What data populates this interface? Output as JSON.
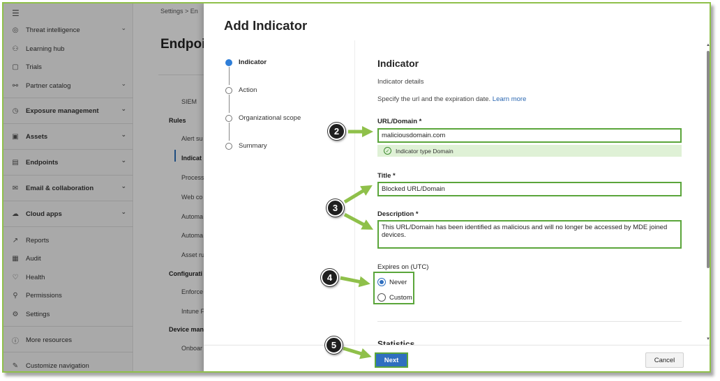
{
  "nav": {
    "items": [
      {
        "label": "Threat intelligence",
        "icon": "threat-icon",
        "chevron": true,
        "bold": false
      },
      {
        "label": "Learning hub",
        "icon": "learning-icon",
        "chevron": false,
        "bold": false
      },
      {
        "label": "Trials",
        "icon": "gift-icon",
        "chevron": false,
        "bold": false
      },
      {
        "label": "Partner catalog",
        "icon": "partner-icon",
        "chevron": true,
        "bold": false
      },
      {
        "label": "Exposure management",
        "icon": "exposure-icon",
        "chevron": true,
        "bold": true
      },
      {
        "label": "Assets",
        "icon": "assets-icon",
        "chevron": true,
        "bold": true
      },
      {
        "label": "Endpoints",
        "icon": "endpoints-icon",
        "chevron": true,
        "bold": true
      },
      {
        "label": "Email & collaboration",
        "icon": "mail-icon",
        "chevron": true,
        "bold": true
      },
      {
        "label": "Cloud apps",
        "icon": "cloud-icon",
        "chevron": true,
        "bold": true
      },
      {
        "label": "Reports",
        "icon": "reports-icon",
        "chevron": false,
        "bold": false
      },
      {
        "label": "Audit",
        "icon": "audit-icon",
        "chevron": false,
        "bold": false
      },
      {
        "label": "Health",
        "icon": "health-icon",
        "chevron": false,
        "bold": false
      },
      {
        "label": "Permissions",
        "icon": "permissions-icon",
        "chevron": false,
        "bold": false
      },
      {
        "label": "Settings",
        "icon": "settings-icon",
        "chevron": false,
        "bold": false
      },
      {
        "label": "More resources",
        "icon": "info-icon",
        "chevron": false,
        "bold": false
      },
      {
        "label": "Customize navigation",
        "icon": "pencil-icon",
        "chevron": false,
        "bold": false
      }
    ]
  },
  "background": {
    "breadcrumb": "Settings  >  En",
    "title": "Endpoi",
    "items": {
      "siem": "SIEM",
      "rules_head": "Rules",
      "alert": "Alert su",
      "indicators": "Indicat",
      "process": "Process",
      "web": "Web co",
      "automa1": "Automa",
      "automa2": "Automa",
      "asset": "Asset ru",
      "config_head": "Configurati",
      "enforce": "Enforce",
      "intune": "Intune F",
      "device_head": "Device man",
      "onboard": "Onboar"
    }
  },
  "dialog": {
    "title": "Add Indicator",
    "steps": [
      {
        "label": "Indicator",
        "active": true
      },
      {
        "label": "Action",
        "active": false
      },
      {
        "label": "Organizational scope",
        "active": false
      },
      {
        "label": "Summary",
        "active": false
      }
    ],
    "form": {
      "heading": "Indicator",
      "subheading": "Indicator details",
      "description": "Specify the url and the expiration date.",
      "learn_more": "Learn more",
      "url_label": "URL/Domain *",
      "url_value": "maliciousdomain.com",
      "validation": "Indicator type Domain",
      "title_label": "Title *",
      "title_value": "Blocked URL/Domain",
      "desc_label": "Description *",
      "desc_value": "This URL/Domain has been identified as malicious and will no longer be accessed by MDE joined devices.",
      "expires_label": "Expires on (UTC)",
      "option_never": "Never",
      "option_custom": "Custom",
      "statistics_heading": "Statistics"
    },
    "buttons": {
      "next": "Next",
      "cancel": "Cancel"
    }
  },
  "callouts": {
    "c2": "2",
    "c3": "3",
    "c4": "4",
    "c5": "5"
  },
  "colors": {
    "accent": "#2f6fbf",
    "highlight": "#5aa53a",
    "arrow": "#8fc04a"
  }
}
